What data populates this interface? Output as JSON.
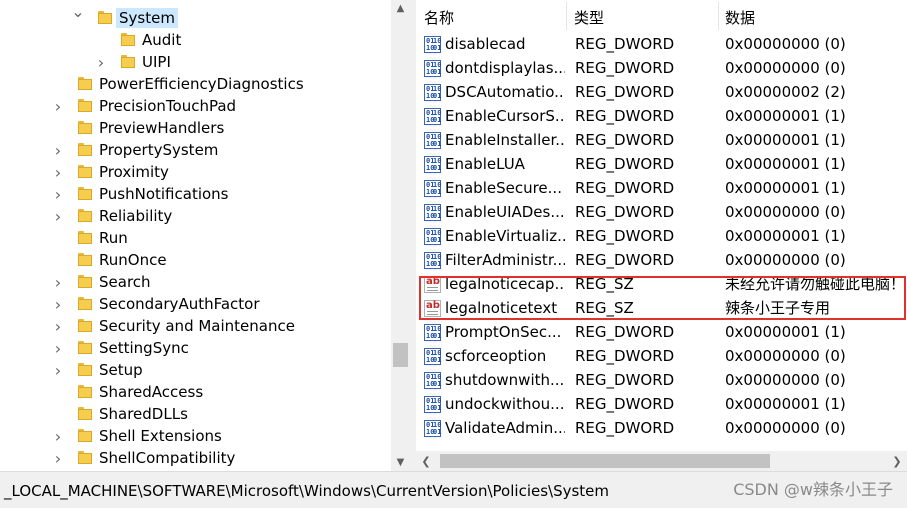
{
  "tree": {
    "items": [
      {
        "label": "System",
        "expander": "expanded",
        "depth": 1,
        "selected": true
      },
      {
        "label": "Audit",
        "expander": "none",
        "depth": 2
      },
      {
        "label": "UIPI",
        "expander": "collapsed",
        "depth": 2
      },
      {
        "label": "PowerEfficiencyDiagnostics",
        "expander": "none",
        "depth": 0
      },
      {
        "label": "PrecisionTouchPad",
        "expander": "collapsed",
        "depth": 0
      },
      {
        "label": "PreviewHandlers",
        "expander": "none",
        "depth": 0
      },
      {
        "label": "PropertySystem",
        "expander": "collapsed",
        "depth": 0
      },
      {
        "label": "Proximity",
        "expander": "collapsed",
        "depth": 0
      },
      {
        "label": "PushNotifications",
        "expander": "collapsed",
        "depth": 0
      },
      {
        "label": "Reliability",
        "expander": "collapsed",
        "depth": 0
      },
      {
        "label": "Run",
        "expander": "none",
        "depth": 0
      },
      {
        "label": "RunOnce",
        "expander": "none",
        "depth": 0
      },
      {
        "label": "Search",
        "expander": "collapsed",
        "depth": 0
      },
      {
        "label": "SecondaryAuthFactor",
        "expander": "collapsed",
        "depth": 0
      },
      {
        "label": "Security and Maintenance",
        "expander": "collapsed",
        "depth": 0
      },
      {
        "label": "SettingSync",
        "expander": "collapsed",
        "depth": 0
      },
      {
        "label": "Setup",
        "expander": "collapsed",
        "depth": 0
      },
      {
        "label": "SharedAccess",
        "expander": "none",
        "depth": 0
      },
      {
        "label": "SharedDLLs",
        "expander": "none",
        "depth": 0
      },
      {
        "label": "Shell Extensions",
        "expander": "collapsed",
        "depth": 0
      },
      {
        "label": "ShellCompatibility",
        "expander": "collapsed",
        "depth": 0
      }
    ]
  },
  "values": {
    "columns": {
      "name": "名称",
      "type": "类型",
      "data": "数据"
    },
    "rows": [
      {
        "name": "disablecad",
        "type": "REG_DWORD",
        "data": "0x00000000 (0)",
        "icon": "binary-value-icon"
      },
      {
        "name": "dontdisplaylas...",
        "type": "REG_DWORD",
        "data": "0x00000000 (0)",
        "icon": "binary-value-icon"
      },
      {
        "name": "DSCAutomatio...",
        "type": "REG_DWORD",
        "data": "0x00000002 (2)",
        "icon": "binary-value-icon"
      },
      {
        "name": "EnableCursorS...",
        "type": "REG_DWORD",
        "data": "0x00000001 (1)",
        "icon": "binary-value-icon"
      },
      {
        "name": "EnableInstaller...",
        "type": "REG_DWORD",
        "data": "0x00000001 (1)",
        "icon": "binary-value-icon"
      },
      {
        "name": "EnableLUA",
        "type": "REG_DWORD",
        "data": "0x00000001 (1)",
        "icon": "binary-value-icon"
      },
      {
        "name": "EnableSecure...",
        "type": "REG_DWORD",
        "data": "0x00000001 (1)",
        "icon": "binary-value-icon"
      },
      {
        "name": "EnableUIADes...",
        "type": "REG_DWORD",
        "data": "0x00000000 (0)",
        "icon": "binary-value-icon"
      },
      {
        "name": "EnableVirtualiz...",
        "type": "REG_DWORD",
        "data": "0x00000001 (1)",
        "icon": "binary-value-icon"
      },
      {
        "name": "FilterAdministr...",
        "type": "REG_DWORD",
        "data": "0x00000000 (0)",
        "icon": "binary-value-icon"
      },
      {
        "name": "legalnoticecap...",
        "type": "REG_SZ",
        "data": "未经允许请勿触碰此电脑！",
        "icon": "string-value-icon"
      },
      {
        "name": "legalnoticetext",
        "type": "REG_SZ",
        "data": "辣条小王子专用",
        "icon": "string-value-icon"
      },
      {
        "name": "PromptOnSec...",
        "type": "REG_DWORD",
        "data": "0x00000001 (1)",
        "icon": "binary-value-icon"
      },
      {
        "name": "scforceoption",
        "type": "REG_DWORD",
        "data": "0x00000000 (0)",
        "icon": "binary-value-icon"
      },
      {
        "name": "shutdownwith...",
        "type": "REG_DWORD",
        "data": "0x00000000 (0)",
        "icon": "binary-value-icon"
      },
      {
        "name": "undockwithou...",
        "type": "REG_DWORD",
        "data": "0x00000001 (1)",
        "icon": "binary-value-icon"
      },
      {
        "name": "ValidateAdmin...",
        "type": "REG_DWORD",
        "data": "0x00000000 (0)",
        "icon": "binary-value-icon"
      }
    ]
  },
  "status": {
    "path": "_LOCAL_MACHINE\\SOFTWARE\\Microsoft\\Windows\\CurrentVersion\\Policies\\System",
    "watermark": "CSDN @w辣条小王子"
  },
  "colors": {
    "highlight": "#e0312b",
    "selection": "#cce8ff",
    "folder": "#f6cd4c"
  }
}
